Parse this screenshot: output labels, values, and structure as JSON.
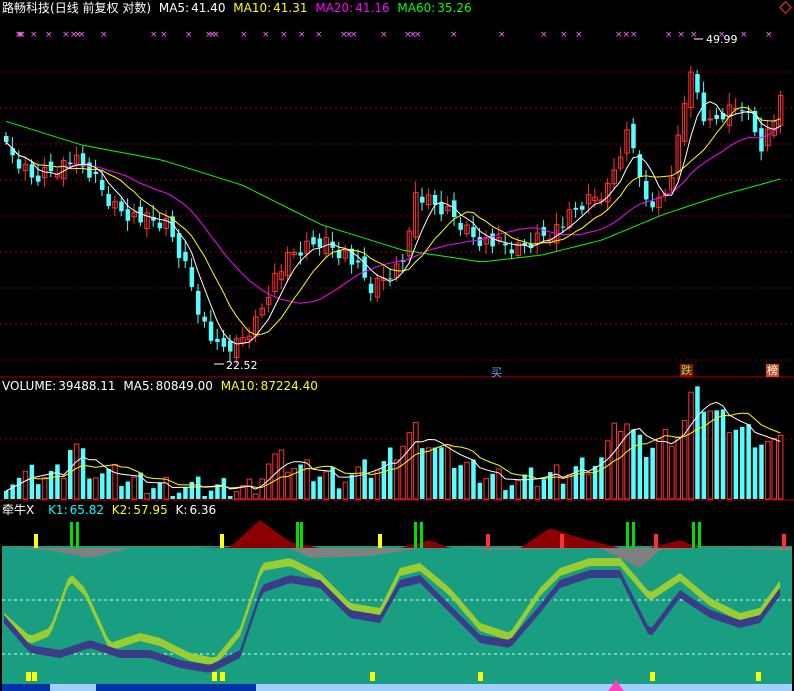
{
  "price_panel": {
    "stock_name": "路畅科技",
    "mode": "(日线 前复权 对数)",
    "ma5_label": "MA5:",
    "ma5_value": "41.40",
    "ma10_label": "MA10:",
    "ma10_value": "41.31",
    "ma20_label": "MA20:",
    "ma20_value": "41.16",
    "ma60_label": "MA60:",
    "ma60_value": "35.26",
    "high_label": "49.99",
    "low_label": "22.52",
    "marker_buy": "买",
    "marker_fall": "跌",
    "marker_rank": "榜",
    "colors": {
      "ma5": "#ffffff",
      "ma10": "#ffff00",
      "ma20": "#ff00ff",
      "ma60": "#00ff00",
      "up": "#ff3232",
      "down": "#54ffff",
      "frame": "#b00000"
    }
  },
  "volume_panel": {
    "label": "VOLUME:",
    "value": "39488.11",
    "ma5_label": "MA5:",
    "ma5_value": "80849.00",
    "ma10_label": "MA10:",
    "ma10_value": "87224.40"
  },
  "indicator_panel": {
    "name": "牵牛X",
    "k1_label": "K1:",
    "k1_value": "65.82",
    "k2_label": "K2:",
    "k2_value": "57.95",
    "k_label": "K:",
    "k_value": "6.36",
    "colors": {
      "bg": "#199e82",
      "k1": "#9acd32",
      "k2": "#3a3c8a"
    }
  }
}
